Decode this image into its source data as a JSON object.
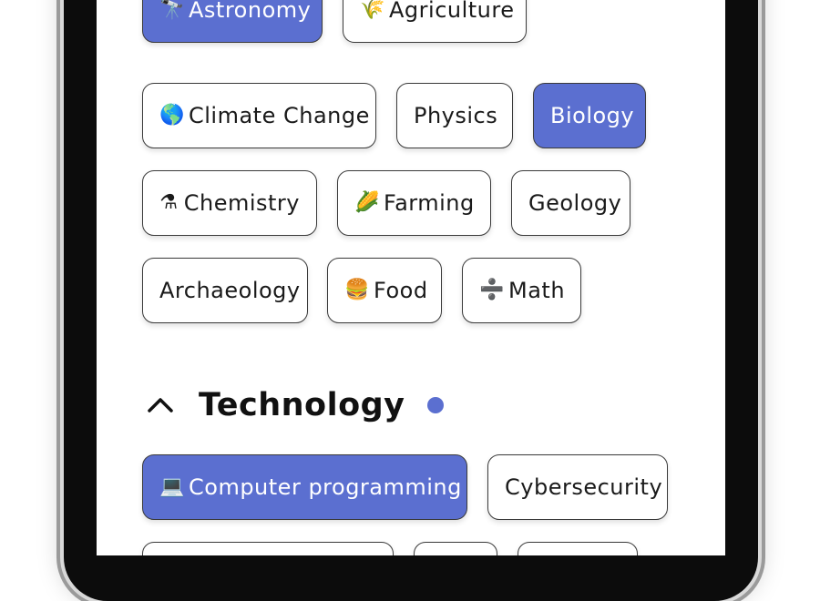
{
  "colors": {
    "accent": "#5b6fd0",
    "chip_border": "#3a3a3a",
    "text": "#1a1a1a"
  },
  "science_chips": [
    [
      {
        "label": "Astronomy",
        "icon": "🔭",
        "icon_name": "telescope-icon",
        "selected": true
      },
      {
        "label": "Agriculture",
        "icon": "🌾",
        "icon_name": "wheat-icon",
        "selected": false
      }
    ],
    [
      {
        "label": "Climate Change",
        "icon": "🌎",
        "icon_name": "globe-icon",
        "selected": false
      },
      {
        "label": "Physics",
        "icon": "",
        "selected": false
      },
      {
        "label": "Biology",
        "icon": "",
        "selected": true
      }
    ],
    [
      {
        "label": "Chemistry",
        "icon": "⚗",
        "icon_name": "flask-icon",
        "selected": false
      },
      {
        "label": "Farming",
        "icon": "🌽",
        "icon_name": "corn-icon",
        "selected": false
      },
      {
        "label": "Geology",
        "icon": "",
        "selected": false
      }
    ],
    [
      {
        "label": "Archaeology",
        "icon": "",
        "selected": false
      },
      {
        "label": "Food",
        "icon": "🍔",
        "icon_name": "burger-icon",
        "selected": false
      },
      {
        "label": "Math",
        "icon": "➗",
        "icon_name": "divide-icon",
        "selected": false
      }
    ]
  ],
  "technology": {
    "title": "Technology",
    "expanded": true,
    "chevron_icon": "chevron-up-icon",
    "indicator": "dot-indicator",
    "chips": [
      [
        {
          "label": "Computer programming",
          "icon": "💻",
          "icon_name": "laptop-icon",
          "selected": true
        },
        {
          "label": "Cybersecurity",
          "icon": "",
          "selected": false
        }
      ]
    ]
  }
}
